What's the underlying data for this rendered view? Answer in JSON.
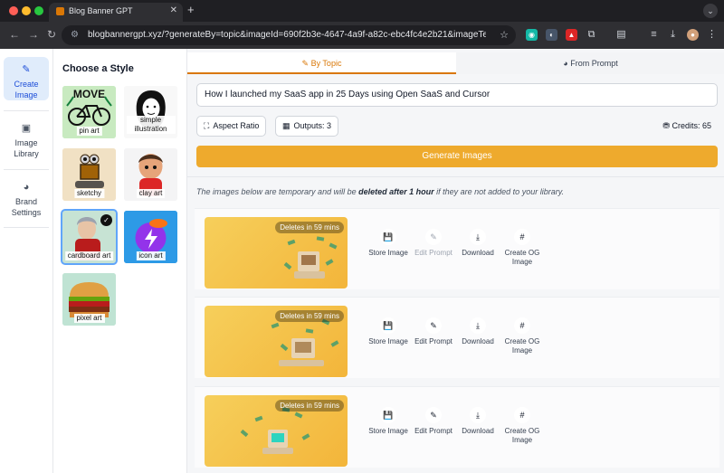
{
  "browser": {
    "tab_title": "Blog Banner GPT",
    "tab_close": "✕",
    "new_tab": "+",
    "url": "blogbannergpt.xyz/?generateBy=topic&imageId=690f2b3e-4647-4a9f-a82c-ebc4fc4e2b21&imageTemplat..."
  },
  "rail": {
    "items": [
      {
        "label": "Create Image",
        "icon": "magic-wand-icon"
      },
      {
        "label": "Image Library",
        "icon": "image-icon"
      },
      {
        "label": "Brand Settings",
        "icon": "palette-icon"
      }
    ]
  },
  "styles": {
    "title": "Choose a Style",
    "items": [
      {
        "label": "pin art"
      },
      {
        "label": "simple illustration"
      },
      {
        "label": "sketchy"
      },
      {
        "label": "clay art"
      },
      {
        "label": "cardboard art",
        "selected": true
      },
      {
        "label": "icon art"
      },
      {
        "label": "pixel art"
      }
    ],
    "pin_text": "MOVE"
  },
  "main": {
    "tab_topic": "By Topic",
    "tab_prompt": "From Prompt",
    "topic_value": "How I launched my SaaS app in 25 Days using Open SaaS and Cursor",
    "aspect_ratio": "Aspect Ratio",
    "outputs": "Outputs: 3",
    "credits": "Credits: 65",
    "generate": "Generate Images",
    "notice_pre": "The images below are temporary and will be ",
    "notice_bold": "deleted after 1 hour",
    "notice_post": " if they are not added to your library."
  },
  "results": [
    {
      "deletes": "Deletes in 59 mins",
      "edit_enabled": false
    },
    {
      "deletes": "Deletes in 59 mins",
      "edit_enabled": true
    },
    {
      "deletes": "Deletes in 59 mins",
      "edit_enabled": true
    }
  ],
  "actions": {
    "store": "Store Image",
    "edit": "Edit Prompt",
    "download": "Download",
    "og": "Create OG Image"
  },
  "colors": {
    "accent": "#d97706",
    "generate": "#eeaa2d",
    "active_rail": "#e0ecfb"
  }
}
